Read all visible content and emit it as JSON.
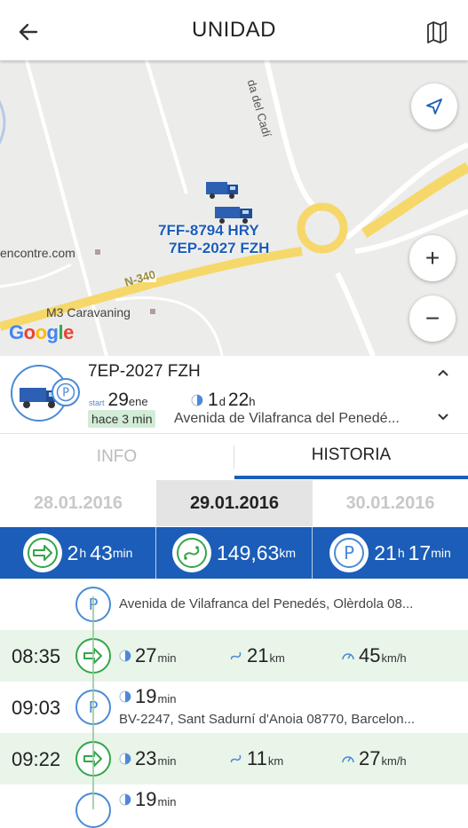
{
  "header": {
    "title": "UNIDAD"
  },
  "map": {
    "pois": [
      "encontre.com",
      "M3 Caravaning"
    ],
    "road_labels": [
      "da del Cadí",
      "N-340"
    ],
    "trucks": [
      "7FF-8794 HRY",
      "7EP-2027 FZH"
    ],
    "zoom_in": "+",
    "zoom_out": "−",
    "google": "Google"
  },
  "vehicle": {
    "name": "7EP-2027 FZH",
    "start_label": "start",
    "start_day": "29",
    "start_month": "ene",
    "duration_days": "1",
    "duration_days_unit": "d",
    "duration_hours": "22",
    "duration_hours_unit": "h",
    "ago": "hace 3 min",
    "address": "Avenida de Vilafranca del Penedé..."
  },
  "tabs": {
    "info": "INFO",
    "historia": "HISTORIA"
  },
  "dates": {
    "prev": "28.01.2016",
    "current": "29.01.2016",
    "next": "30.01.2016"
  },
  "summary": {
    "drive_h": "2",
    "drive_h_unit": "h",
    "drive_min": "43",
    "drive_min_unit": "min",
    "distance": "149,63",
    "distance_unit": "km",
    "park_h": "21",
    "park_h_unit": "h",
    "park_min": "17",
    "park_min_unit": "min"
  },
  "timeline": {
    "first_address": "Avenida de Vilafranca del Penedés, Olèrdola 08...",
    "rows": [
      {
        "time": "08:35",
        "duration": "27",
        "duration_unit": "min",
        "distance": "21",
        "distance_unit": "km",
        "speed": "45",
        "speed_unit": "km/h"
      },
      {
        "time": "09:03",
        "duration": "19",
        "duration_unit": "min",
        "address": "BV-2247, Sant Sadurní d'Anoia 08770, Barcelon..."
      },
      {
        "time": "09:22",
        "duration": "23",
        "duration_unit": "min",
        "distance": "11",
        "distance_unit": "km",
        "speed": "27",
        "speed_unit": "km/h"
      },
      {
        "duration": "19",
        "duration_unit": "min"
      }
    ]
  },
  "colors": {
    "brand_blue": "#1b5db8",
    "drive_green": "#33a64a",
    "drive_row_bg": "#e9f5e9",
    "road_yellow": "#f6d86a"
  }
}
